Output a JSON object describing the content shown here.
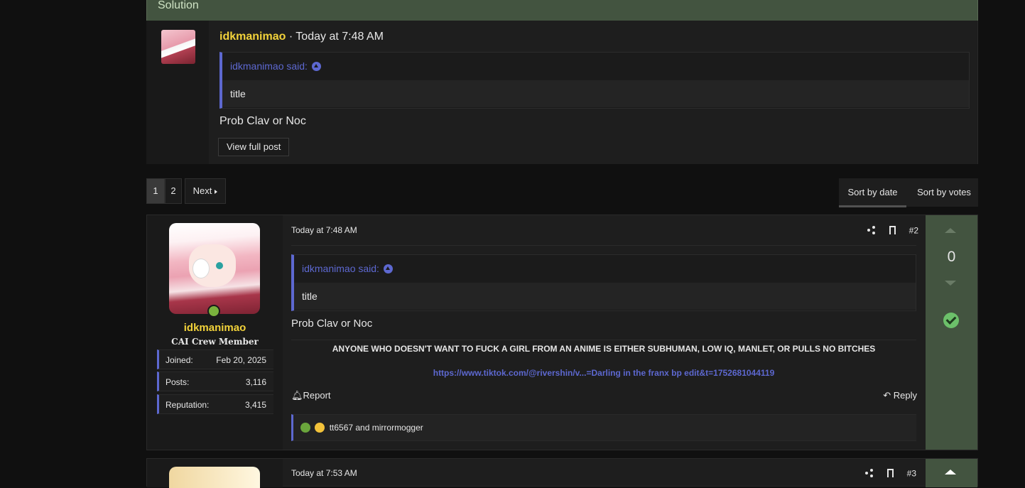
{
  "solution": {
    "header": "Solution",
    "username": "idkmanimao",
    "time": "· Today at 7:48 AM",
    "quote_author": "idkmanimao said:",
    "quote_text": "title",
    "text": "Prob Clav or Noc",
    "view_full": "View full post"
  },
  "pagination": {
    "pages": [
      "1",
      "2"
    ],
    "next": "Next"
  },
  "sort": {
    "by_date": "Sort by date",
    "by_votes": "Sort by votes"
  },
  "post": {
    "time": "Today at 7:48 AM",
    "number": "#2",
    "username": "idkmanimao",
    "user_title": "CAI Crew Member",
    "stats": [
      {
        "k": "Joined:",
        "v": "Feb 20, 2025"
      },
      {
        "k": "Posts:",
        "v": "3,116"
      },
      {
        "k": "Reputation:",
        "v": "3,415"
      }
    ],
    "quote_author": "idkmanimao said:",
    "quote_text": "title",
    "text": "Prob Clav or Noc",
    "signature": "ANYONE WHO DOESN'T WANT TO FUCK A GIRL FROM AN ANIME IS EITHER SUBHUMAN, LOW IQ, MANLET, OR PULLS NO BITCHES",
    "signature_link": "https://www.tiktok.com/@rivershin/v...=Darling in the franx bp edit&t=1752681044119",
    "report": "Report",
    "reply": "Reply",
    "reactions": "tt6567 and mirrormogger",
    "votes": "0"
  },
  "post3": {
    "time": "Today at 7:53 AM",
    "number": "#3"
  }
}
